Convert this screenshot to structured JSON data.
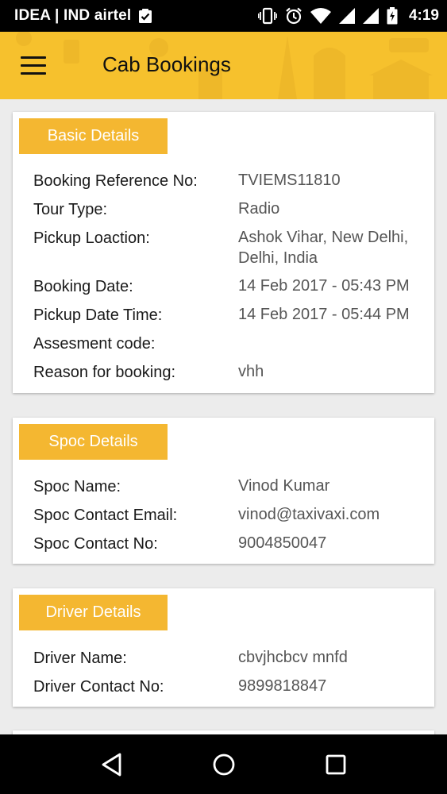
{
  "status_bar": {
    "carrier": "IDEA | IND airtel",
    "time": "4:19"
  },
  "app_bar": {
    "title": "Cab Bookings"
  },
  "sections": {
    "basic": {
      "title": "Basic Details",
      "rows": [
        {
          "label": "Booking Reference No:",
          "value": "TVIEMS11810"
        },
        {
          "label": "Tour Type:",
          "value": "Radio"
        },
        {
          "label": "Pickup Loaction:",
          "value": "Ashok Vihar, New Delhi, Delhi, India"
        },
        {
          "label": "Booking Date:",
          "value": "14 Feb 2017 - 05:43 PM"
        },
        {
          "label": "Pickup Date Time:",
          "value": "14 Feb 2017 - 05:44 PM"
        },
        {
          "label": "Assesment code:",
          "value": ""
        },
        {
          "label": "Reason for booking:",
          "value": "vhh"
        }
      ]
    },
    "spoc": {
      "title": "Spoc Details",
      "rows": [
        {
          "label": "Spoc Name:",
          "value": "Vinod Kumar"
        },
        {
          "label": "Spoc Contact Email:",
          "value": "vinod@taxivaxi.com"
        },
        {
          "label": "Spoc Contact No:",
          "value": "9004850047"
        }
      ]
    },
    "driver": {
      "title": "Driver Details",
      "rows": [
        {
          "label": "Driver Name:",
          "value": "cbvjhcbcv mnfd"
        },
        {
          "label": "Driver Contact No:",
          "value": "9899818847"
        }
      ]
    }
  },
  "icons": {
    "menu": "hamburger-icon",
    "back": "back-triangle-icon",
    "home": "home-circle-icon",
    "recents": "recents-square-icon"
  }
}
